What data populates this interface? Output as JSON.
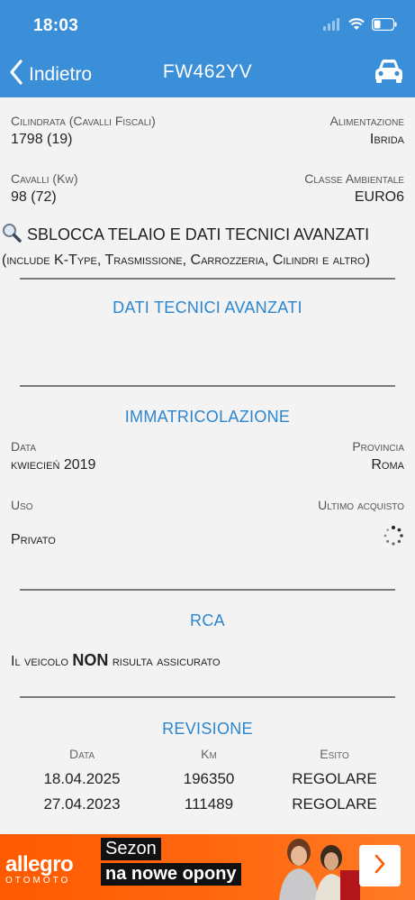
{
  "status_bar": {
    "time": "18:03"
  },
  "nav": {
    "back_label": "Indietro",
    "title": "FW462YV"
  },
  "specs": {
    "cilindrata_label": "Cilindrata (Cavalli Fiscali)",
    "cilindrata_value": "1798 (19)",
    "alimentazione_label": "Alimentazione",
    "alimentazione_value": "Ibrida",
    "cavalli_label": "Cavalli (Kw)",
    "cavalli_value": "98 (72)",
    "classe_label": "Classe Ambientale",
    "classe_value": "EURO6"
  },
  "unlock": {
    "line1": "SBLOCCA TELAIO E DATI TECNICI AVANZATI",
    "line2": "(include K-Type, Trasmissione, Carrozzeria, Cilindri e altro)"
  },
  "sections": {
    "dati_tecnici": "DATI TECNICI AVANZATI",
    "immatricolazione": "IMMATRICOLAZIONE",
    "rca": "RCA",
    "revisione": "REVISIONE"
  },
  "immatricolazione": {
    "data_label": "Data",
    "data_value": "kwiecień 2019",
    "provincia_label": "Provincia",
    "provincia_value": "Roma",
    "uso_label": "Uso",
    "uso_value": "Privato",
    "ultimo_label": "Ultimo acquisto"
  },
  "rca": {
    "text_before": "Il veicolo",
    "text_bold": "NON",
    "text_after": "risulta assicurato"
  },
  "revisione": {
    "headers": [
      "Data",
      "Km",
      "Esito"
    ],
    "rows": [
      [
        "18.04.2025",
        "196350",
        "REGOLARE"
      ],
      [
        "27.04.2023",
        "111489",
        "REGOLARE"
      ]
    ]
  },
  "ad": {
    "logo": "allegro",
    "logo_sub": "OTOMOTO",
    "line1": "Sezon",
    "line2": "na nowe opony"
  },
  "colors": {
    "header_bg": "#3b8fd9",
    "section_title": "#2c86cf",
    "ad_bg": "#ff5a00"
  },
  "icons": {
    "back": "chevron-left-icon",
    "car": "car-icon",
    "search": "magnifier-icon",
    "loading": "spinner-icon",
    "ad_arrow": "chevron-right-icon"
  }
}
